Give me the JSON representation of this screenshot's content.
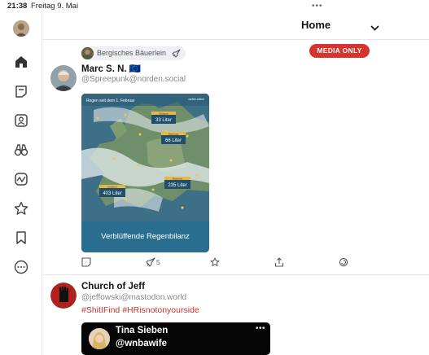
{
  "status_bar": {
    "time": "21:38",
    "date": "Freitag 9. Mai",
    "more_dots": "•••"
  },
  "header": {
    "title": "Home",
    "dropdown_icon": "chevron-down-icon"
  },
  "filter_badge": {
    "label": "MEDIA ONLY",
    "color": "#d7332f"
  },
  "sidebar": {
    "items": [
      {
        "icon": "home-icon"
      },
      {
        "icon": "notifications-icon"
      },
      {
        "icon": "profile-icon"
      },
      {
        "icon": "explore-binoculars-icon"
      },
      {
        "icon": "activity-icon"
      },
      {
        "icon": "favorites-star-icon"
      },
      {
        "icon": "bookmark-icon"
      },
      {
        "icon": "more-icon"
      }
    ]
  },
  "posts": [
    {
      "boosted_by": "Bergisches Bäuerlein",
      "author_name": "Marc S. N. 🇪🇺",
      "handle": "@Spreepunk@norden.social",
      "media": {
        "header_text": "Regen seit dem 1. Februar",
        "source_text": "wetter.online",
        "caption": "Verblüffende Regenbilanz",
        "callouts": [
          {
            "region": "Glasgow",
            "value": "33 Liter"
          },
          {
            "region": "Hamburg",
            "value": "66 Liter"
          },
          {
            "region": "Lissabon",
            "value": "403 Liter"
          },
          {
            "region": "Ravenna",
            "value": "235 Liter"
          }
        ]
      },
      "actions": {
        "boost_count": "5"
      }
    },
    {
      "author_name": "Church of Jeff",
      "handle": "@jeffowski@mastodon.world",
      "hashtags": "#ShitIFind #HRisnotonyourside",
      "embed": {
        "name": "Tina Sieben",
        "handle": "@wnbawife",
        "more": "•••"
      }
    }
  ],
  "colors": {
    "accent": "#d7332f",
    "hashtag": "#c8332b",
    "caption_bg": "#2a6e8f"
  }
}
